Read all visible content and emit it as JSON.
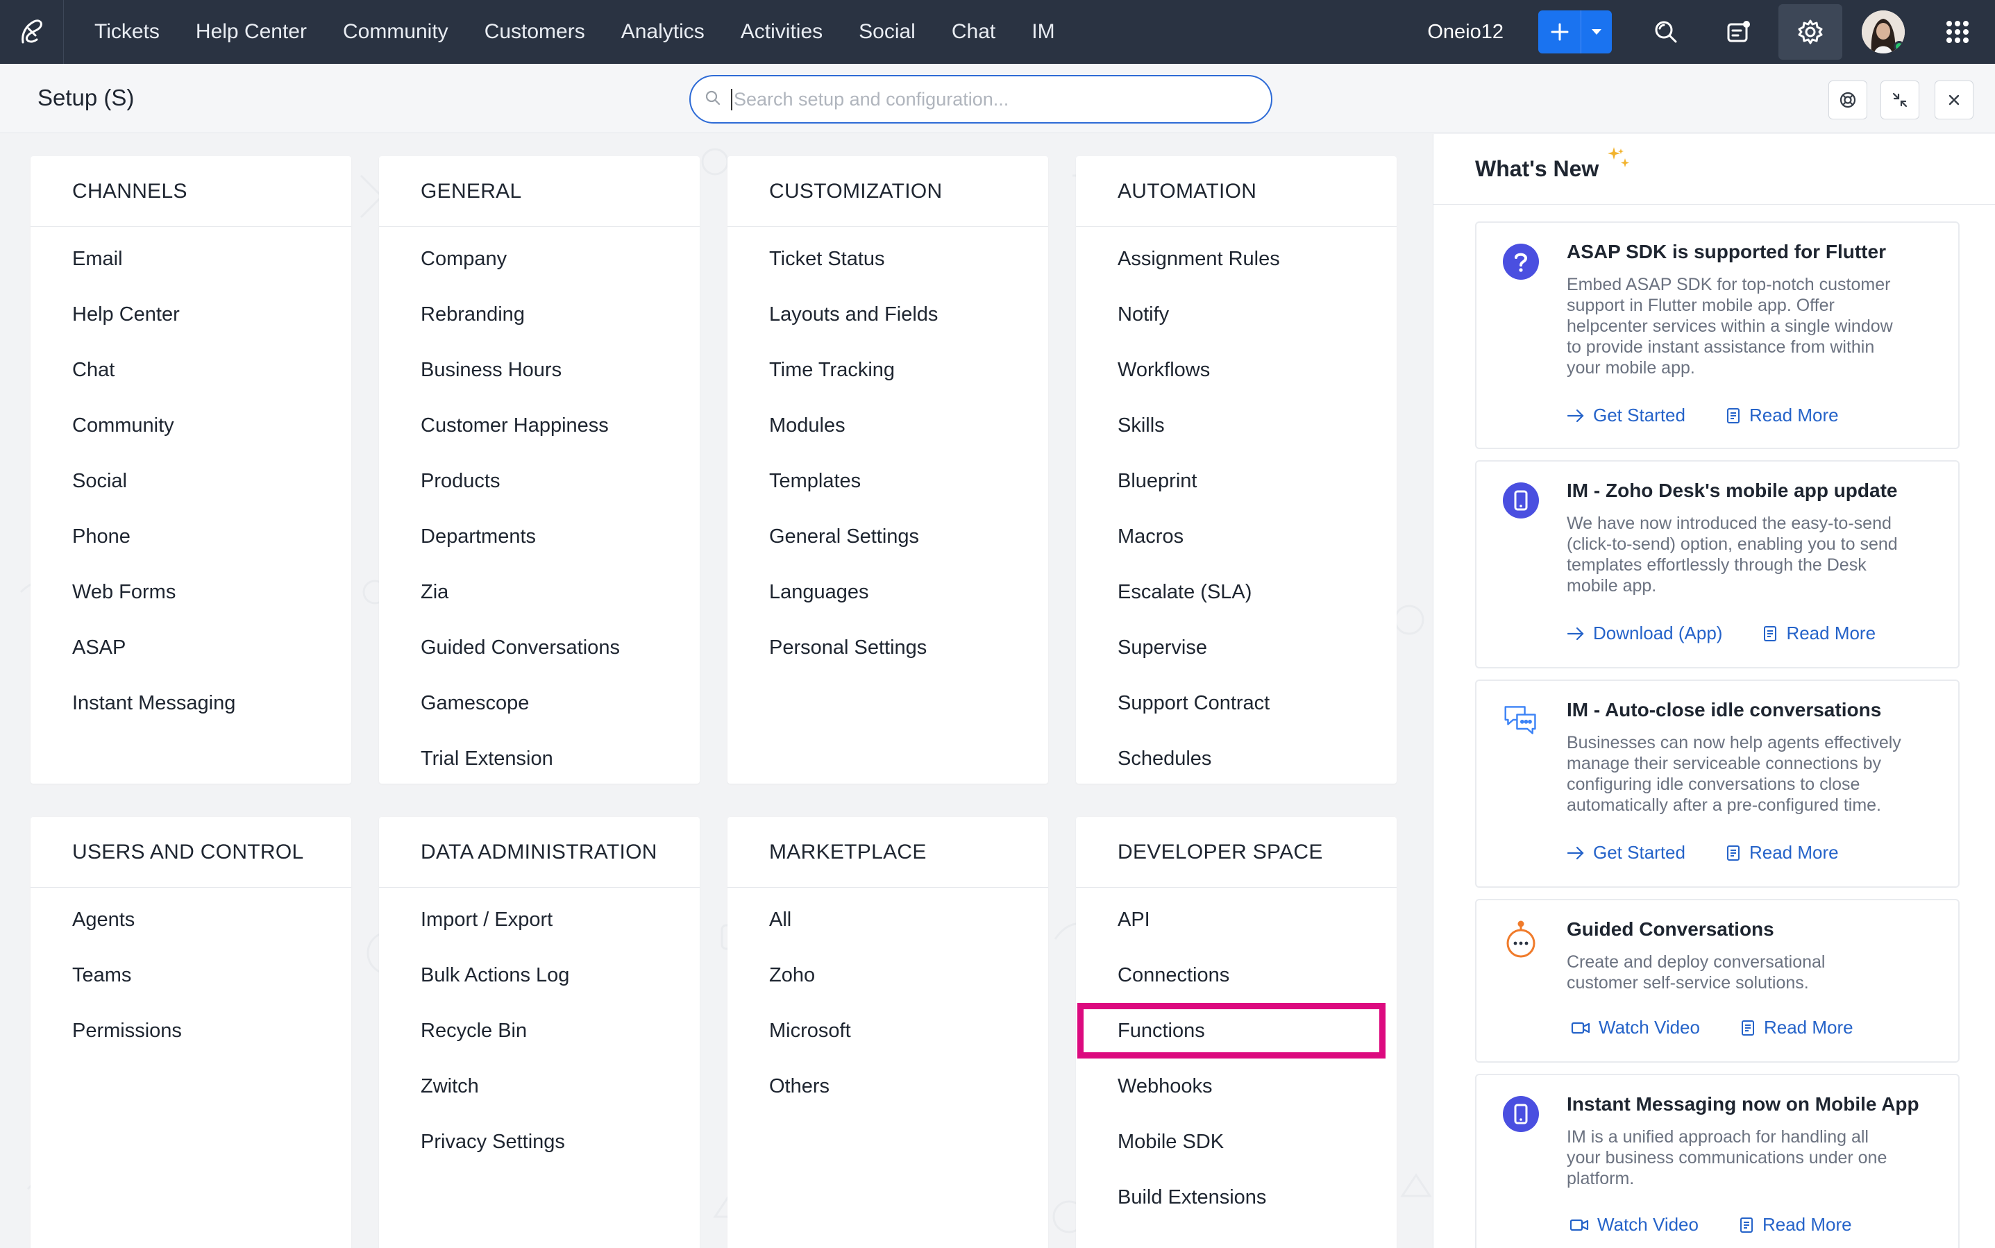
{
  "topnav": {
    "items": [
      {
        "label": "Tickets"
      },
      {
        "label": "Help Center"
      },
      {
        "label": "Community"
      },
      {
        "label": "Customers"
      },
      {
        "label": "Analytics"
      },
      {
        "label": "Activities"
      },
      {
        "label": "Social"
      },
      {
        "label": "Chat"
      },
      {
        "label": "IM"
      }
    ],
    "account_name": "Oneio12",
    "icons": [
      "zoho-desk-logo-icon",
      "plus-icon",
      "caret-down-icon",
      "search-icon",
      "notes-icon",
      "gear-icon",
      "avatar",
      "apps-grid-icon"
    ]
  },
  "setup_header": {
    "title": "Setup (S)",
    "search_placeholder": "Search setup and configuration...",
    "icons": [
      "support-lifebuoy-icon",
      "collapse-icon",
      "close-icon"
    ]
  },
  "sections": [
    {
      "title": "CHANNELS",
      "items": [
        "Email",
        "Help Center",
        "Chat",
        "Community",
        "Social",
        "Phone",
        "Web Forms",
        "ASAP",
        "Instant Messaging"
      ]
    },
    {
      "title": "GENERAL",
      "items": [
        "Company",
        "Rebranding",
        "Business Hours",
        "Customer Happiness",
        "Products",
        "Departments",
        "Zia",
        "Guided Conversations",
        "Gamescope",
        "Trial Extension"
      ]
    },
    {
      "title": "CUSTOMIZATION",
      "items": [
        "Ticket Status",
        "Layouts and Fields",
        "Time Tracking",
        "Modules",
        "Templates",
        "General Settings",
        "Languages",
        "Personal Settings"
      ]
    },
    {
      "title": "AUTOMATION",
      "items": [
        "Assignment Rules",
        "Notify",
        "Workflows",
        "Skills",
        "Blueprint",
        "Macros",
        "Escalate (SLA)",
        "Supervise",
        "Support Contract",
        "Schedules"
      ]
    },
    {
      "title": "USERS AND CONTROL",
      "items": [
        "Agents",
        "Teams",
        "Permissions"
      ]
    },
    {
      "title": "DATA ADMINISTRATION",
      "items": [
        "Import / Export",
        "Bulk Actions Log",
        "Recycle Bin",
        "Zwitch",
        "Privacy Settings"
      ]
    },
    {
      "title": "MARKETPLACE",
      "items": [
        "All",
        "Zoho",
        "Microsoft",
        "Others"
      ]
    },
    {
      "title": "DEVELOPER SPACE",
      "items": [
        "API",
        "Connections",
        "Functions",
        "Webhooks",
        "Mobile SDK",
        "Build Extensions"
      ]
    }
  ],
  "highlight": {
    "section": "DEVELOPER SPACE",
    "item": "Functions",
    "color": "#dc0a7f"
  },
  "whats_new": {
    "title": "What's New",
    "cards": [
      {
        "icon": "question-icon",
        "title": "ASAP SDK is supported for Flutter",
        "description": [
          "Embed ASAP SDK for top-notch customer",
          "support in Flutter mobile app. Offer",
          "helpcenter services within a single window",
          "to provide instant assistance from within",
          "your mobile app."
        ],
        "actions": [
          {
            "icon": "arrow-right-icon",
            "label": "Get Started"
          },
          {
            "icon": "doc-icon",
            "label": "Read More"
          }
        ]
      },
      {
        "icon": "mobile-icon",
        "title": "IM - Zoho Desk's mobile app update",
        "description": [
          "We have now introduced the easy-to-send",
          "(click-to-send) option, enabling you to send",
          "templates effortlessly through the Desk",
          "mobile app."
        ],
        "actions": [
          {
            "icon": "arrow-right-icon",
            "label": "Download (App)"
          },
          {
            "icon": "doc-icon",
            "label": "Read More"
          }
        ]
      },
      {
        "icon": "chat-bubbles-icon",
        "title": "IM - Auto-close idle conversations",
        "description": [
          "Businesses can now help agents effectively",
          "manage their serviceable connections by",
          "configuring idle conversations to close",
          "automatically after a pre-configured time."
        ],
        "actions": [
          {
            "icon": "arrow-right-icon",
            "label": "Get Started"
          },
          {
            "icon": "doc-icon",
            "label": "Read More"
          }
        ]
      },
      {
        "icon": "bot-icon",
        "title": "Guided Conversations",
        "description": [
          "Create and deploy conversational",
          "customer self-service solutions."
        ],
        "actions": [
          {
            "icon": "video-icon",
            "label": "Watch Video"
          },
          {
            "icon": "doc-icon",
            "label": "Read More"
          }
        ]
      },
      {
        "icon": "mobile-icon",
        "title": "Instant Messaging now on Mobile App",
        "description": [
          "IM is a unified approach for handling all",
          "your business communications under one",
          "platform."
        ],
        "actions": [
          {
            "icon": "video-icon",
            "label": "Watch Video"
          },
          {
            "icon": "doc-icon",
            "label": "Read More"
          }
        ]
      }
    ]
  },
  "colors": {
    "topnav_bg": "#2a3342",
    "accent_blue": "#1a73f0",
    "link_blue": "#2563c9",
    "icon_purple": "#4a4fe0",
    "bot_orange": "#f07b2b"
  }
}
